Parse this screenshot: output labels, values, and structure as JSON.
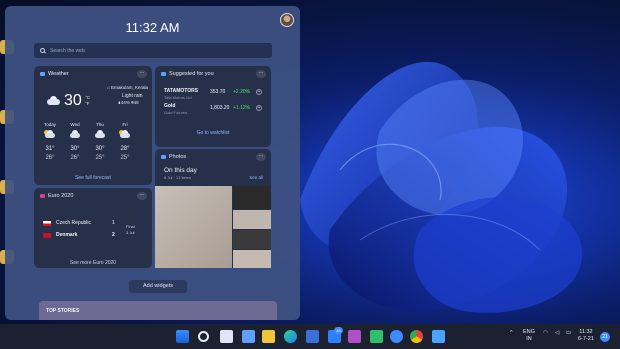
{
  "panel": {
    "time": "11:32 AM",
    "search_placeholder": "Search the web",
    "add_widgets": "Add widgets",
    "top_stories": "TOP STORIES"
  },
  "weather": {
    "title": "Weather",
    "location": "Ernakulam, Kerala",
    "temperature": "30",
    "unit_c": "°C",
    "unit_f": "°F",
    "condition": "Light rain",
    "humidity": "44%",
    "wind": "49",
    "forecast": [
      {
        "day": "Today",
        "high": "31°",
        "low": "26°",
        "icon": "partly-cloudy-icon"
      },
      {
        "day": "Wed",
        "high": "30°",
        "low": "26°",
        "icon": "rain-cloud-icon"
      },
      {
        "day": "Thu",
        "high": "30°",
        "low": "25°",
        "icon": "rain-cloud-icon"
      },
      {
        "day": "Fri",
        "high": "28°",
        "low": "25°",
        "icon": "partly-cloudy-icon"
      }
    ],
    "link": "See full forecast"
  },
  "stocks": {
    "title": "Suggested for you",
    "items": [
      {
        "name": "TATAMOTORS",
        "sub": "Tata Motors Ltd",
        "value": "353.70",
        "change": "+2.20%"
      },
      {
        "name": "Gold",
        "sub": "Gold Futures",
        "value": "1,803.20",
        "change": "+1.12%"
      }
    ],
    "link": "Go to watchlist"
  },
  "photos": {
    "title": "Photos",
    "heading": "On this day",
    "date": "6 Jul · 13 items",
    "see_all": "See all"
  },
  "euro": {
    "title": "Euro 2020",
    "team1": "Czech Republic",
    "score1": "1",
    "team2": "Denmark",
    "score2": "2",
    "status": "Final",
    "date": "3 Jul",
    "link": "See more Euro 2020"
  },
  "taskbar": {
    "lang1": "ENG",
    "lang2": "IN",
    "time": "11:32",
    "date": "6-7-21",
    "badge": "48",
    "notifications": "21"
  }
}
